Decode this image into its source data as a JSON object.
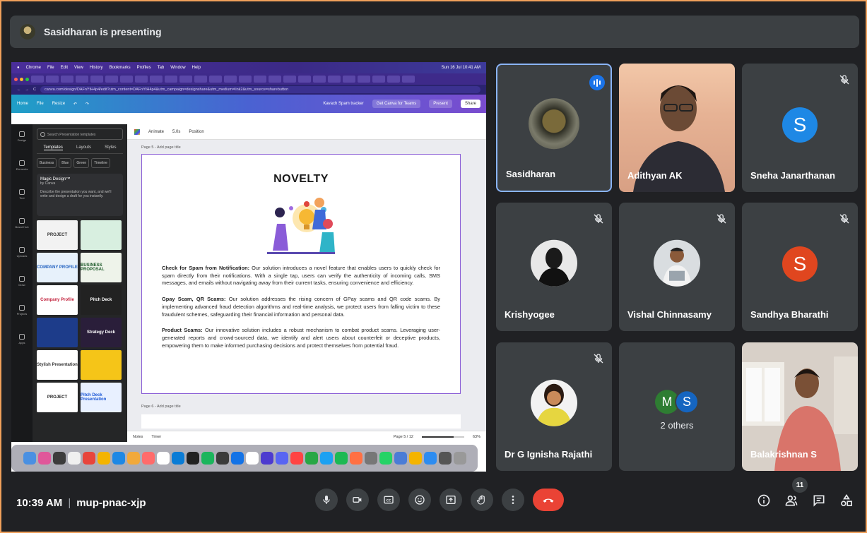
{
  "banner": {
    "text": "Sasidharan is presenting"
  },
  "shared": {
    "menu": [
      "Chrome",
      "File",
      "Edit",
      "View",
      "History",
      "Bookmarks",
      "Profiles",
      "Tab",
      "Window",
      "Help"
    ],
    "clock": "Sun 16 Jul 10:41 AM",
    "url": "canva.com/design/DAFnYtH4p4/edit?utm_content=DAFnYtH4p4&utm_campaign=designshare&utm_medium=link2&utm_source=sharebutton",
    "canva": {
      "home": "Home",
      "file": "File",
      "resize": "Resize",
      "doc_title": "Kavach Spam tracker",
      "teams": "Get Canva for Teams",
      "present": "Present",
      "share": "Share"
    },
    "rail": [
      "Design",
      "Elements",
      "Text",
      "Brand Hub",
      "Uploads",
      "Draw",
      "Projects",
      "Apps"
    ],
    "panel": {
      "search_placeholder": "Search Presentation templates",
      "tabs": [
        "Templates",
        "Layouts",
        "Styles"
      ],
      "chips": [
        "Business",
        "Blue",
        "Green",
        "Timeline"
      ],
      "magic_title": "Magic Design™",
      "magic_sub": "by Canva",
      "magic_desc": "Describe the presentation you want, and we'll write and design a draft for you instantly.",
      "thumbs": [
        "PROJECT",
        "",
        "COMPANY PROFILE",
        "BUSINESS PROPOSAL",
        "Company Profile",
        "Pitch Deck",
        "",
        "Strategy Deck",
        "Stylish Presentation",
        "",
        "PROJECT",
        "Pitch Deck Presentation"
      ]
    },
    "toolbar": {
      "animate": "Animate",
      "duration": "5.0s",
      "position": "Position"
    },
    "page5_label": "Page 5 - Add page title",
    "page6_label": "Page 6 - Add page title",
    "slide": {
      "title": "NOVELTY",
      "p1_head": "Check for Spam from Notification:",
      "p1_body": " Our solution introduces a novel feature that enables users to quickly check for spam directly from their notifications. With a single tap, users can verify the authenticity of incoming calls, SMS messages, and emails without navigating away from their current tasks, ensuring convenience and efficiency.",
      "p2_head": "Gpay Scam, QR Scams:",
      "p2_body": " Our solution addresses the rising concern of GPay scams and QR code scams. By implementing advanced fraud detection algorithms and real-time analysis, we protect users from falling victim to these fraudulent schemes, safeguarding their financial information and personal data.",
      "p3_head": "Product Scams:",
      "p3_body": " Our innovative solution includes a robust mechanism to combat product scams. Leveraging user-generated reports and crowd-sourced data, we identify and alert users about counterfeit or deceptive products, empowering them to make informed purchasing decisions and protect themselves from potential fraud."
    },
    "status": {
      "notes": "Notes",
      "timer": "Timer",
      "page": "Page 5 / 12",
      "zoom": "63%"
    }
  },
  "participants": [
    {
      "name": "Sasidharan",
      "type": "photo",
      "active": true
    },
    {
      "name": "Adithyan AK",
      "type": "video"
    },
    {
      "name": "Sneha Janarthanan",
      "type": "letter",
      "letter": "S",
      "color": "#1e88e5",
      "muted": true
    },
    {
      "name": "Krishyogee",
      "type": "photo",
      "muted": true
    },
    {
      "name": "Vishal Chinnasamy",
      "type": "photo",
      "muted": true
    },
    {
      "name": "Sandhya Bharathi",
      "type": "letter",
      "letter": "S",
      "color": "#e0461f",
      "muted": true
    },
    {
      "name": "Dr G Ignisha Rajathi",
      "type": "photo",
      "muted": true
    },
    {
      "name": "2 others",
      "type": "others",
      "letters": [
        "M",
        "S"
      ],
      "colors": [
        "#2e7d32",
        "#1565c0"
      ]
    },
    {
      "name": "Balakrishnan S",
      "type": "video"
    }
  ],
  "bottom": {
    "time": "10:39 AM",
    "meeting_code": "mup-pnac-xjp",
    "people_count": "11"
  }
}
